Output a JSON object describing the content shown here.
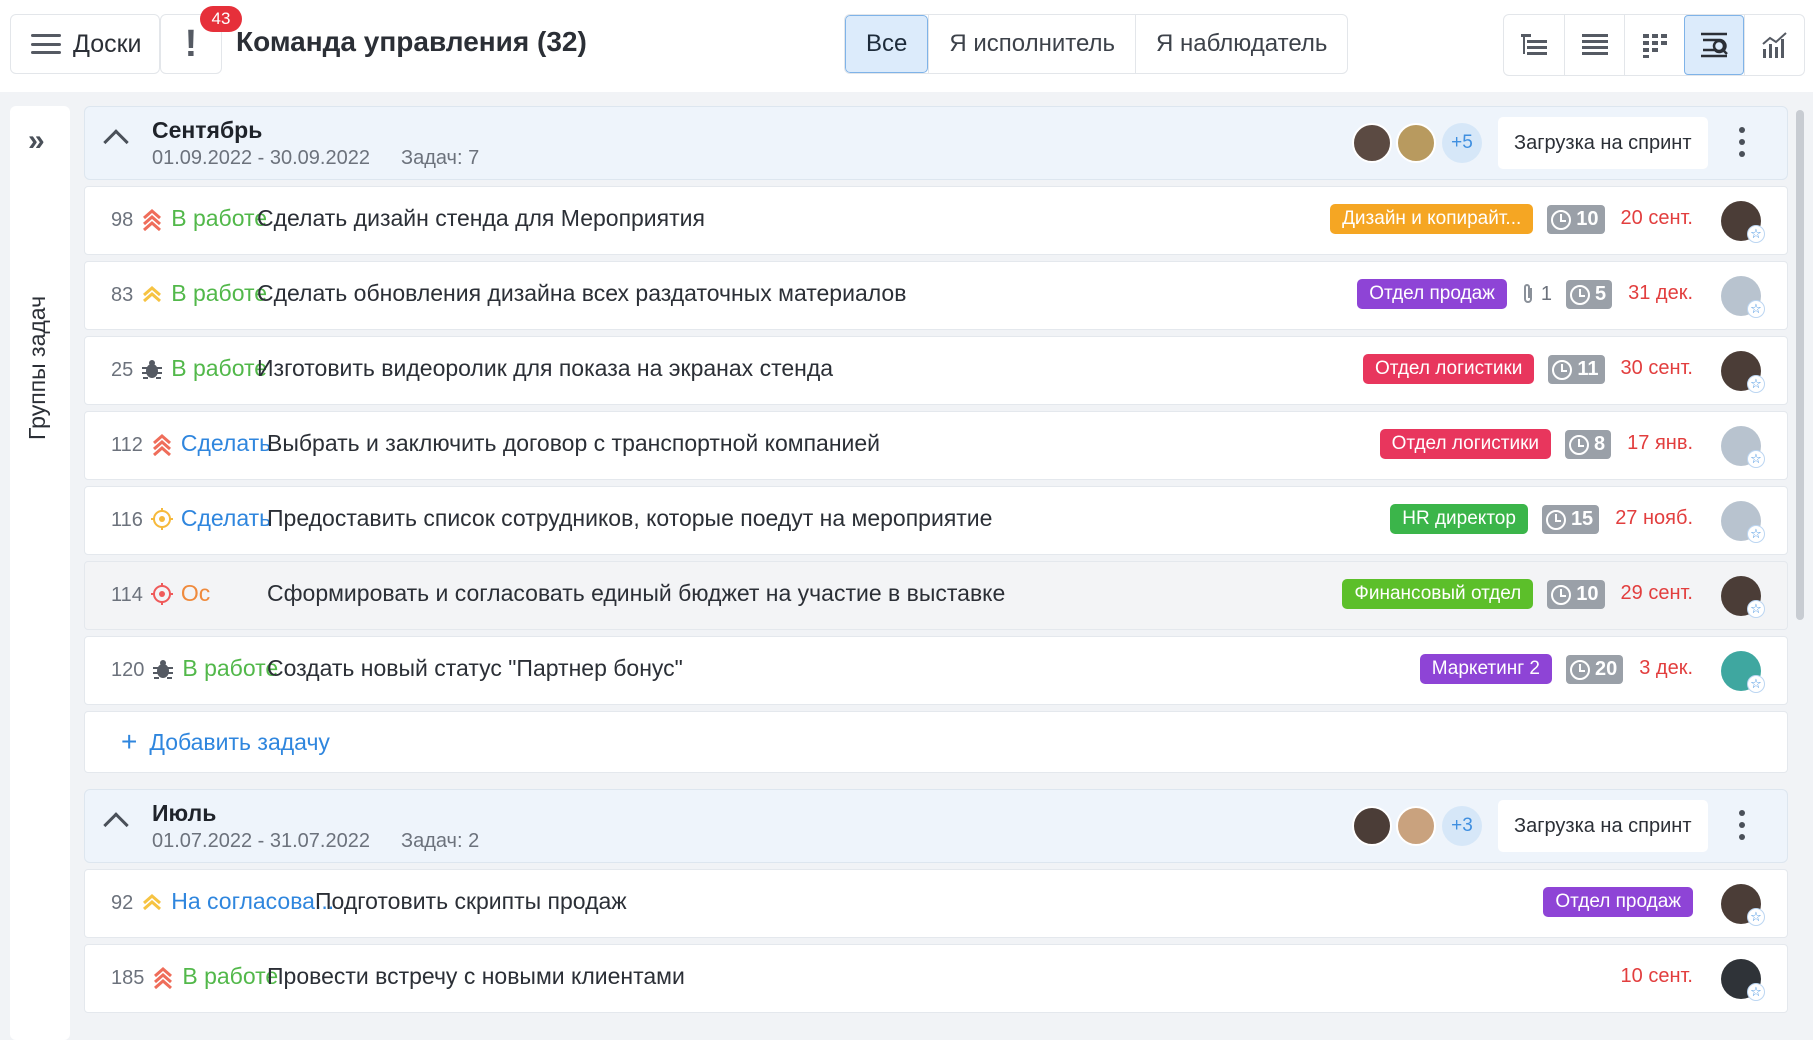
{
  "topbar": {
    "boards_label": "Доски",
    "alert_mark": "!",
    "alert_count": "43",
    "team_title": "Команда управления (32)",
    "filters": [
      {
        "label": "Все",
        "active": true
      },
      {
        "label": "Я исполнитель",
        "active": false
      },
      {
        "label": "Я наблюдатель",
        "active": false
      }
    ],
    "views": [
      {
        "icon": "tree-list-icon",
        "active": false
      },
      {
        "icon": "list-icon",
        "active": false
      },
      {
        "icon": "grid-icon",
        "active": false
      },
      {
        "icon": "sprint-view-icon",
        "active": true
      },
      {
        "icon": "analytics-icon",
        "active": false
      }
    ]
  },
  "sidebar": {
    "toggle": "»",
    "label": "Группы задач"
  },
  "groups": [
    {
      "name": "Сентябрь",
      "dates": "01.09.2022 - 30.09.2022",
      "count": "Задач: 7",
      "avatar_colors": [
        "#5b4a42",
        "#b89a5f"
      ],
      "more": "+5",
      "sprint_button": "Загрузка на спринт",
      "add_task": "Добавить задачу",
      "tasks": [
        {
          "id": "98",
          "priority": "high",
          "status": "В работе",
          "status_color": "green",
          "title": "Сделать дизайн стенда для Мероприятия",
          "tag": "Дизайн и копирайт...",
          "tag_color": "#f5a623",
          "attach": "",
          "timer": "10",
          "due": "20 сент.",
          "avatar_color": "#4b3d37",
          "highlight": false
        },
        {
          "id": "83",
          "priority": "medium",
          "status": "В работе",
          "status_color": "green",
          "title": "Сделать обновления дизайна всех раздаточных материалов",
          "tag": "Отдел продаж",
          "tag_color": "#8e44d6",
          "attach": "1",
          "timer": "5",
          "due": "31 дек.",
          "avatar_color": "#b8c3cf",
          "highlight": false
        },
        {
          "id": "25",
          "priority": "bug",
          "status": "В работе",
          "status_color": "green",
          "title": "Изготовить видеоролик для показа на экранах стенда",
          "tag": "Отдел логистики",
          "tag_color": "#e8365d",
          "attach": "",
          "timer": "11",
          "due": "30 сент.",
          "avatar_color": "#4b3d37",
          "highlight": false
        },
        {
          "id": "112",
          "priority": "high",
          "status": "Сделать",
          "status_color": "blue",
          "title": "Выбрать и заключить договор с транспортной компанией",
          "tag": "Отдел логистики",
          "tag_color": "#e8365d",
          "attach": "",
          "timer": "8",
          "due": "17 янв.",
          "avatar_color": "#b8c3cf",
          "highlight": false
        },
        {
          "id": "116",
          "priority": "target-yellow",
          "status": "Сделать",
          "status_color": "blue",
          "title": "Предоставить список сотрудников, которые поедут на мероприятие",
          "tag": "HR директор",
          "tag_color": "#3bb54a",
          "attach": "",
          "timer": "15",
          "due": "27 нояб.",
          "avatar_color": "#b8c3cf",
          "highlight": false
        },
        {
          "id": "114",
          "priority": "target-red",
          "status": "Ос",
          "status_color": "orange",
          "title": "Сформировать и согласовать единый бюджет на участие в выставке",
          "tag": "Финансовый отдел",
          "tag_color": "#5cbf2a",
          "attach": "",
          "timer": "10",
          "due": "29 сент.",
          "avatar_color": "#4b3d37",
          "highlight": true
        },
        {
          "id": "120",
          "priority": "bug",
          "status": "В работе",
          "status_color": "green",
          "title": "Создать новый статус \"Партнер бонус\"",
          "tag": "Маркетинг 2",
          "tag_color": "#8e44d6",
          "attach": "",
          "timer": "20",
          "due": "3 дек.",
          "avatar_color": "#3fa7a0",
          "highlight": false
        }
      ]
    },
    {
      "name": "Июль",
      "dates": "01.07.2022 - 31.07.2022",
      "count": "Задач: 2",
      "avatar_colors": [
        "#4b3d37",
        "#c9a27e"
      ],
      "more": "+3",
      "sprint_button": "Загрузка на спринт",
      "add_task": "",
      "tasks": [
        {
          "id": "92",
          "priority": "medium",
          "status": "На согласова...",
          "status_color": "blue",
          "title": "Подготовить скрипты продаж",
          "tag": "Отдел продаж",
          "tag_color": "#8e44d6",
          "attach": "",
          "timer": "",
          "due": "",
          "avatar_color": "#4b3d37",
          "highlight": false
        },
        {
          "id": "185",
          "priority": "high",
          "status": "В работе",
          "status_color": "green",
          "title": "Провести встречу с новыми клиентами",
          "tag": "",
          "tag_color": "",
          "attach": "",
          "timer": "",
          "due": "10 сент.",
          "avatar_color": "#2f3338",
          "highlight": false
        }
      ]
    }
  ]
}
